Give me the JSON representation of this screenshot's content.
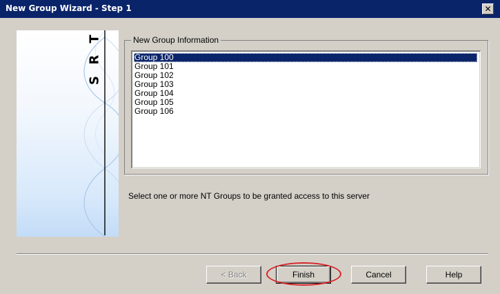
{
  "window": {
    "title": "New Group Wizard - Step 1",
    "close_glyph": "✕"
  },
  "banner": {
    "logo_letters": [
      "T",
      "R",
      "S"
    ],
    "gradient_colors": [
      "#ffffff",
      "#c3dcf7"
    ]
  },
  "groupbox": {
    "legend": "New Group Information"
  },
  "groups_list": {
    "items": [
      "Group 100",
      "Group 101",
      "Group 102",
      "Group 103",
      "Group 104",
      "Group 105",
      "Group 106"
    ],
    "selected_index": 0
  },
  "instruction": "Select one or more NT Groups to be granted access to this server",
  "buttons": {
    "back": "< Back",
    "finish": "Finish",
    "cancel": "Cancel",
    "help": "Help"
  },
  "colors": {
    "titlebar": "#0a246a",
    "dialog_face": "#d4d0c8",
    "selection": "#0a246a",
    "highlight_annotation": "#d9262a"
  }
}
